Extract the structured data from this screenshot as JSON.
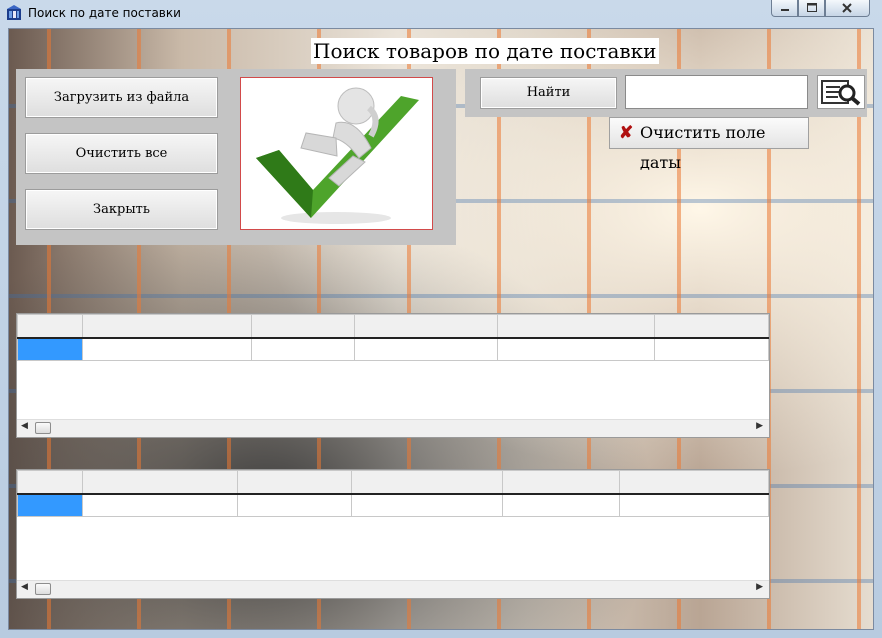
{
  "window": {
    "title": "Поиск по дате поставки",
    "controls": [
      "minimize",
      "maximize",
      "close"
    ]
  },
  "heading": "Поиск товаров по дате поставки",
  "left_panel": {
    "buttons": {
      "load": "Загрузить из файла",
      "clear_all": "Очистить все",
      "close": "Закрыть"
    },
    "picture": "figure-with-checkmark-image"
  },
  "right_panel": {
    "find_button": "Найти",
    "date_field": {
      "value": "",
      "placeholder": ""
    },
    "search_icon": "magnifier-document-icon"
  },
  "clear_date_button": {
    "icon": "red-x-icon",
    "label": "Очистить поле даты"
  },
  "colors": {
    "selection": "#3399ff",
    "panel": "#c4c4c4",
    "picture_border": "#d24a4a"
  },
  "grids": [
    {
      "columns": 5,
      "rows": 1
    },
    {
      "columns": 5,
      "rows": 1
    }
  ]
}
